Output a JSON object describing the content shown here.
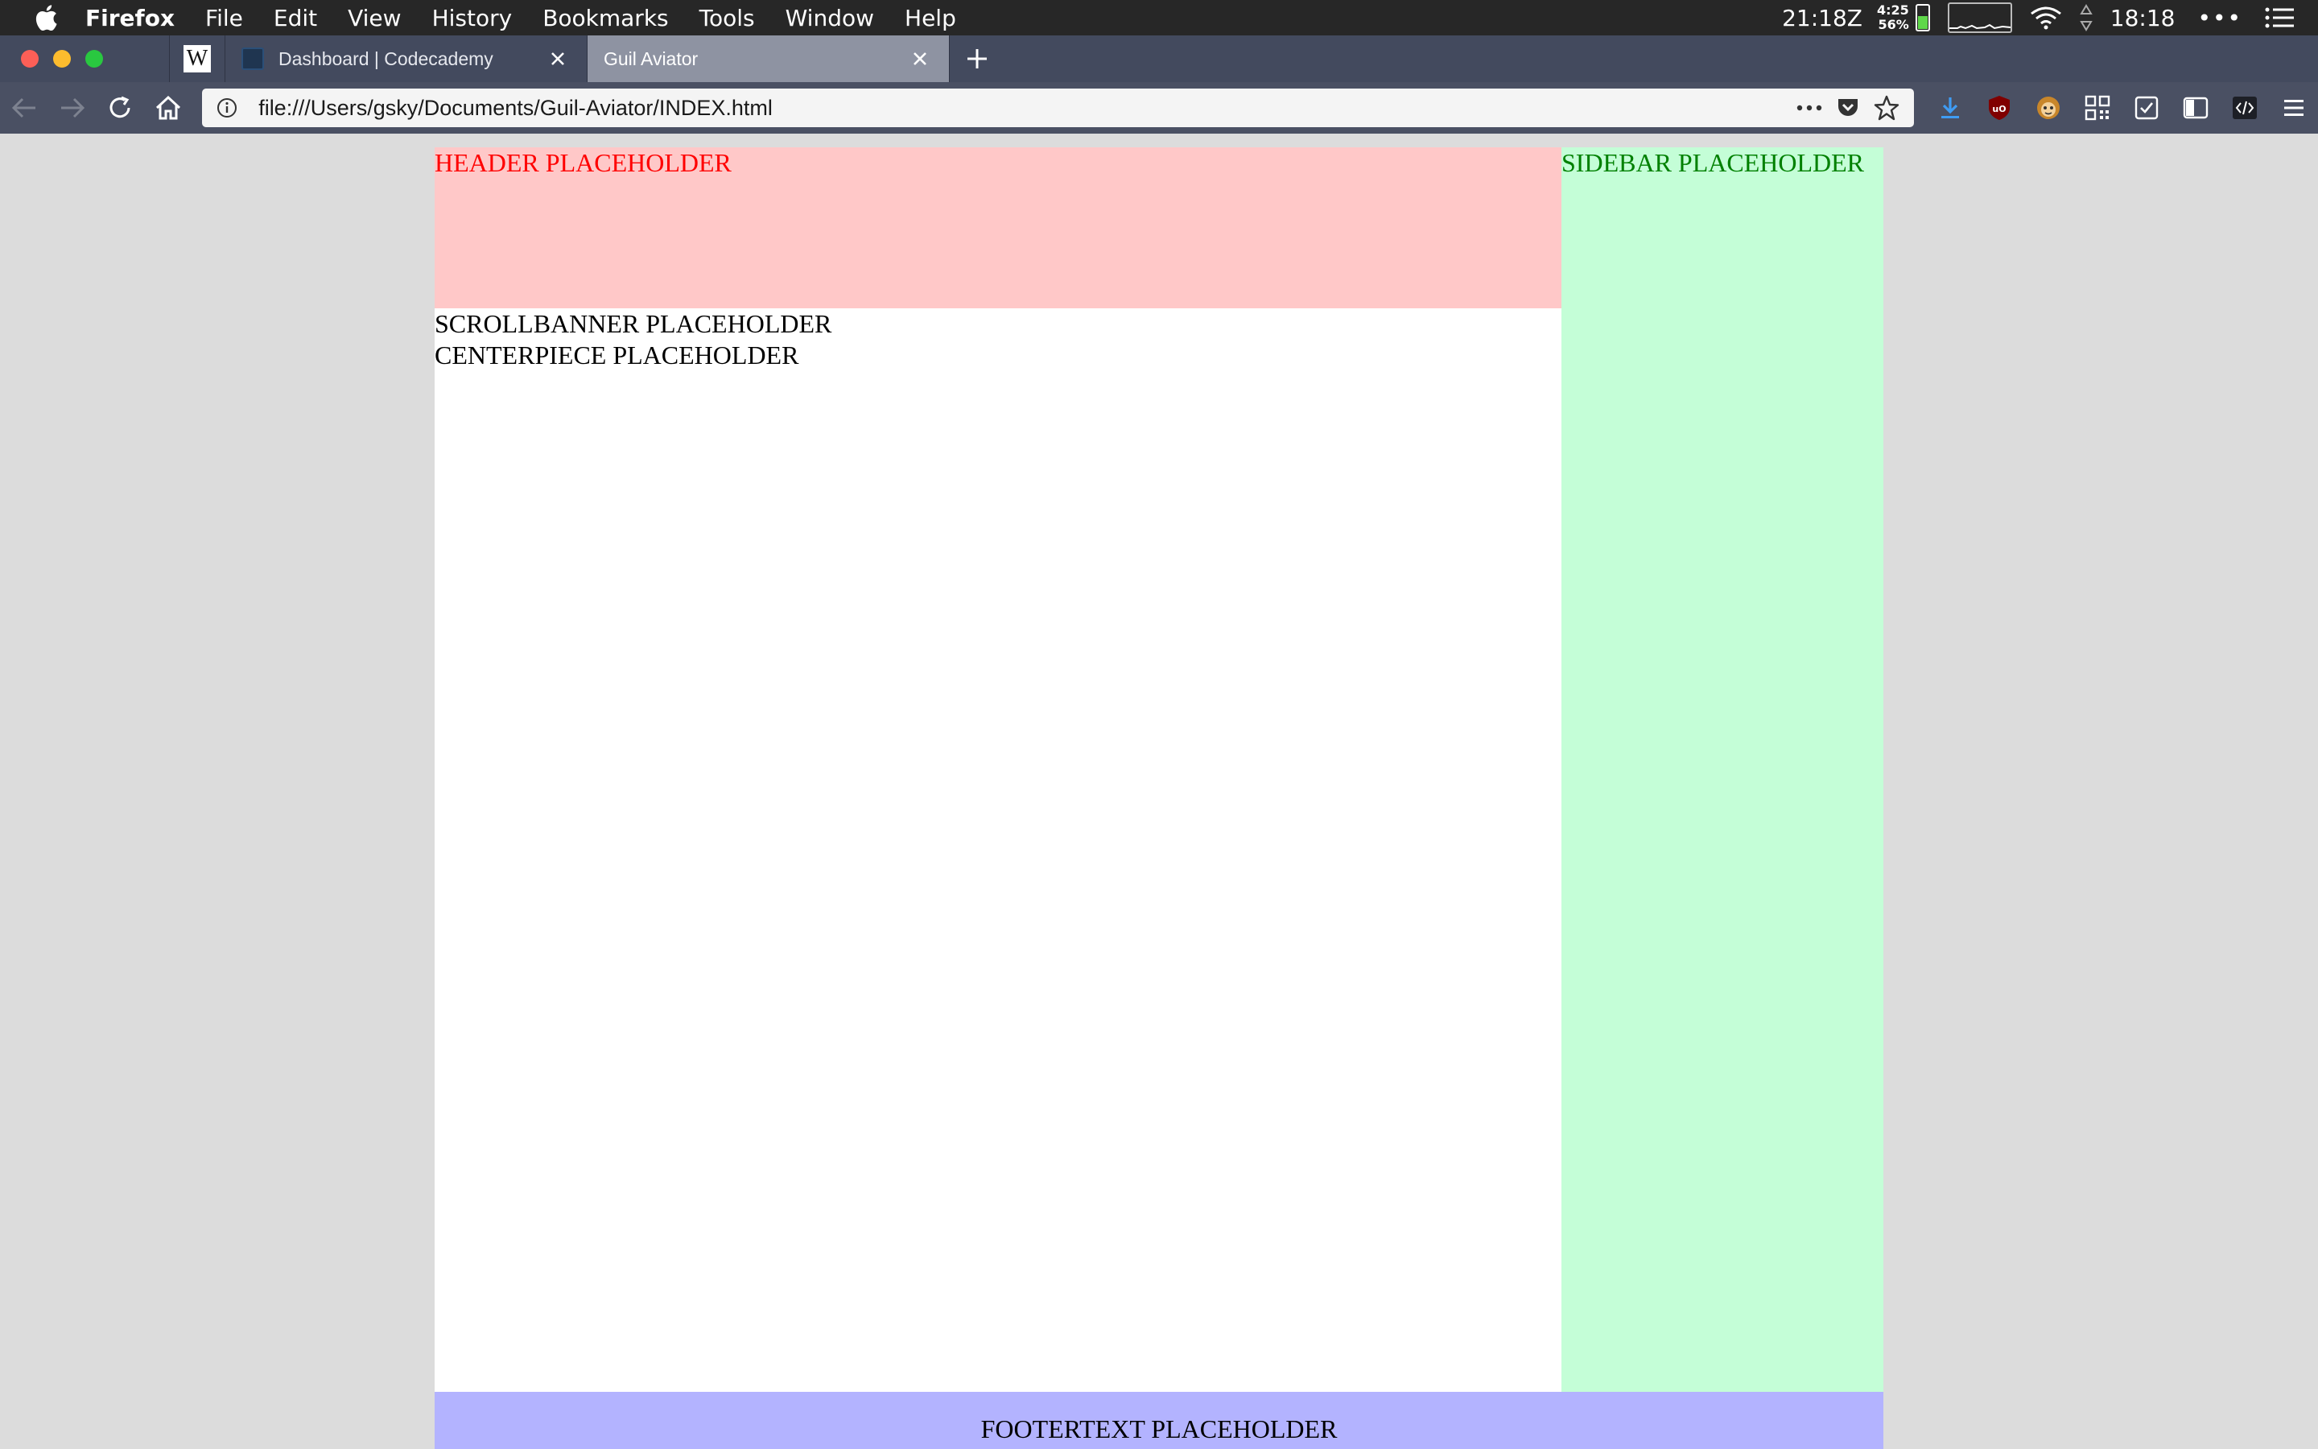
{
  "menubar": {
    "app_name": "Firefox",
    "items": [
      "File",
      "Edit",
      "View",
      "History",
      "Bookmarks",
      "Tools",
      "Window",
      "Help"
    ],
    "status": {
      "zulu_time": "21:18Z",
      "battery_time": "4:25",
      "battery_percent": "56%",
      "clock": "18:18"
    }
  },
  "tabs": [
    {
      "title": "Dashboard | Codecademy",
      "active": false
    },
    {
      "title": "Guil Aviator",
      "active": true
    }
  ],
  "navbar": {
    "url": "file:///Users/gsky/Documents/Guil-Aviator/INDEX.html"
  },
  "page": {
    "header_text": "HEADER PLACEHOLDER",
    "sidebar_text": "SIDEBAR PLACEHOLDER",
    "scrollbanner_text": "SCROLLBANNER PLACEHOLDER",
    "centerpiece_text": "CENTERPIECE PLACEHOLDER",
    "footer_text": "FOOTERTEXT PLACEHOLDER"
  },
  "colors": {
    "header_bg": "#ffc8c8",
    "header_text": "#ff0000",
    "sidebar_bg": "#c4fed7",
    "sidebar_text": "#008000",
    "footer_bg": "#b3b3ff",
    "page_bg": "#dcdcdc"
  }
}
